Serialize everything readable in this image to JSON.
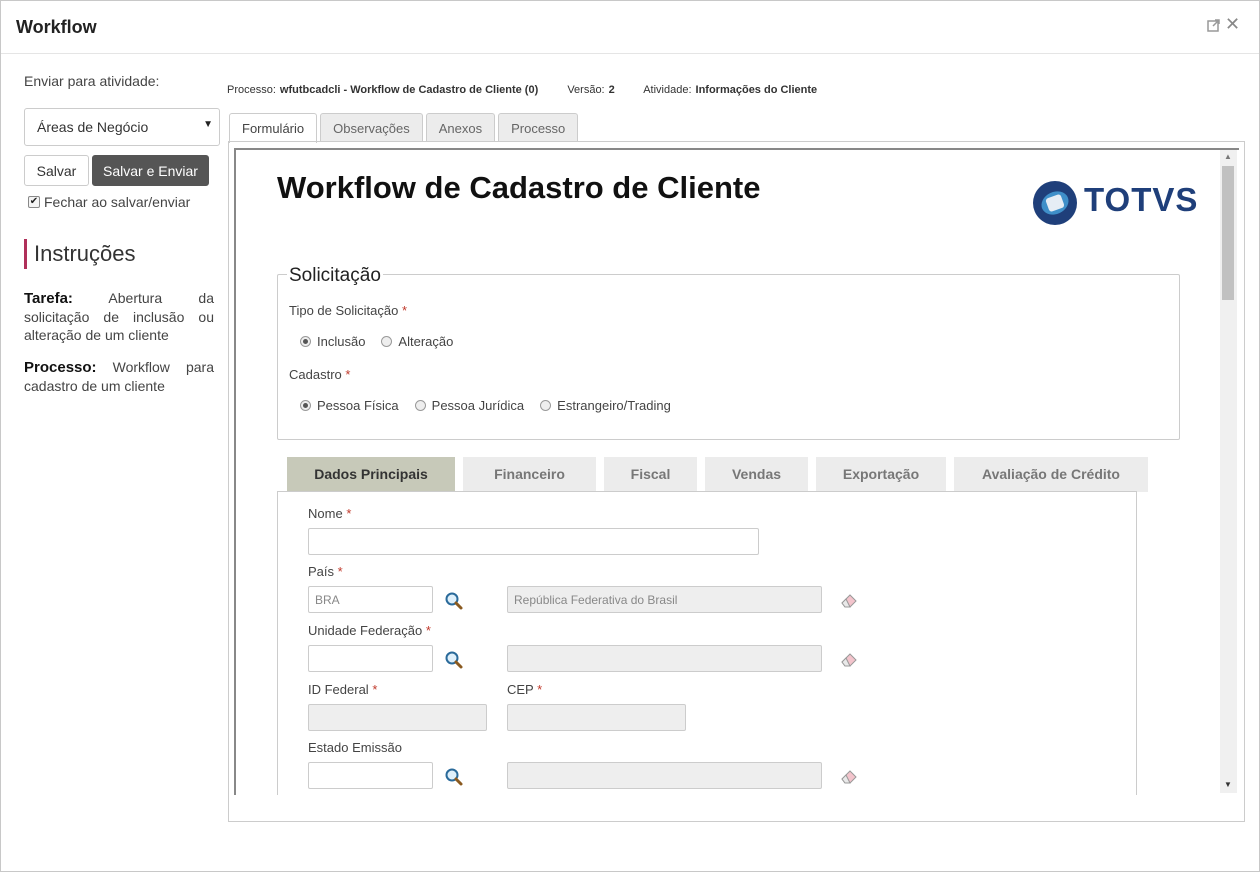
{
  "window": {
    "title": "Workflow"
  },
  "sidebar": {
    "send_label": "Enviar para atividade:",
    "activity_select": "Áreas de Negócio",
    "save_label": "Salvar",
    "save_send_label": "Salvar e Enviar",
    "close_on_save_label": "Fechar ao salvar/enviar",
    "close_on_save_checked": true,
    "instructions_title": "Instruções",
    "task_label": "Tarefa:",
    "task_text": "Abertura da solicitação de inclusão ou alteração de um cliente",
    "process_label": "Processo:",
    "process_text": "Workflow para cadastro de um cliente"
  },
  "meta": {
    "process_label": "Processo:",
    "process_value": "wfutbcadcli - Workflow de Cadastro de Cliente (0)",
    "version_label": "Versão:",
    "version_value": "2",
    "activity_label": "Atividade:",
    "activity_value": "Informações do Cliente"
  },
  "outer_tabs": [
    {
      "label": "Formulário",
      "active": true
    },
    {
      "label": "Observações",
      "active": false
    },
    {
      "label": "Anexos",
      "active": false
    },
    {
      "label": "Processo",
      "active": false
    }
  ],
  "form": {
    "title": "Workflow de Cadastro de Cliente",
    "logo_text": "TOTVS",
    "section_title": "Solicitação",
    "tipo_label": "Tipo de Solicitação",
    "tipo_options": [
      {
        "label": "Inclusão",
        "selected": true
      },
      {
        "label": "Alteração",
        "selected": false
      }
    ],
    "cadastro_label": "Cadastro",
    "cadastro_options": [
      {
        "label": "Pessoa Física",
        "selected": true
      },
      {
        "label": "Pessoa Jurídica",
        "selected": false
      },
      {
        "label": "Estrangeiro/Trading",
        "selected": false
      }
    ],
    "required_mark": "*",
    "inner_tabs": [
      {
        "label": "Dados Principais",
        "active": true
      },
      {
        "label": "Financeiro",
        "active": false
      },
      {
        "label": "Fiscal",
        "active": false
      },
      {
        "label": "Vendas",
        "active": false
      },
      {
        "label": "Exportação",
        "active": false
      },
      {
        "label": "Avaliação de Crédito",
        "active": false
      }
    ],
    "nome_label": "Nome",
    "nome_value": "",
    "pais_label": "País",
    "pais_code": "BRA",
    "pais_name": "República Federativa do Brasil",
    "uf_label": "Unidade Federação",
    "uf_code": "",
    "uf_name": "",
    "id_federal_label": "ID Federal",
    "id_federal_value": "",
    "cep_label": "CEP",
    "cep_value": "",
    "estado_emissao_label": "Estado Emissão",
    "estado_emissao_code": "",
    "estado_emissao_name": ""
  },
  "icons": {
    "restore": "restore-window-icon",
    "close": "close-icon",
    "search": "magnifier-icon",
    "clear": "eraser-icon"
  },
  "colors": {
    "accent_bar": "#b0305a",
    "primary_button": "#555555",
    "active_inner_tab": "#c7c9b9",
    "logo_blue": "#1f3f7a",
    "required": "#c0392b"
  }
}
